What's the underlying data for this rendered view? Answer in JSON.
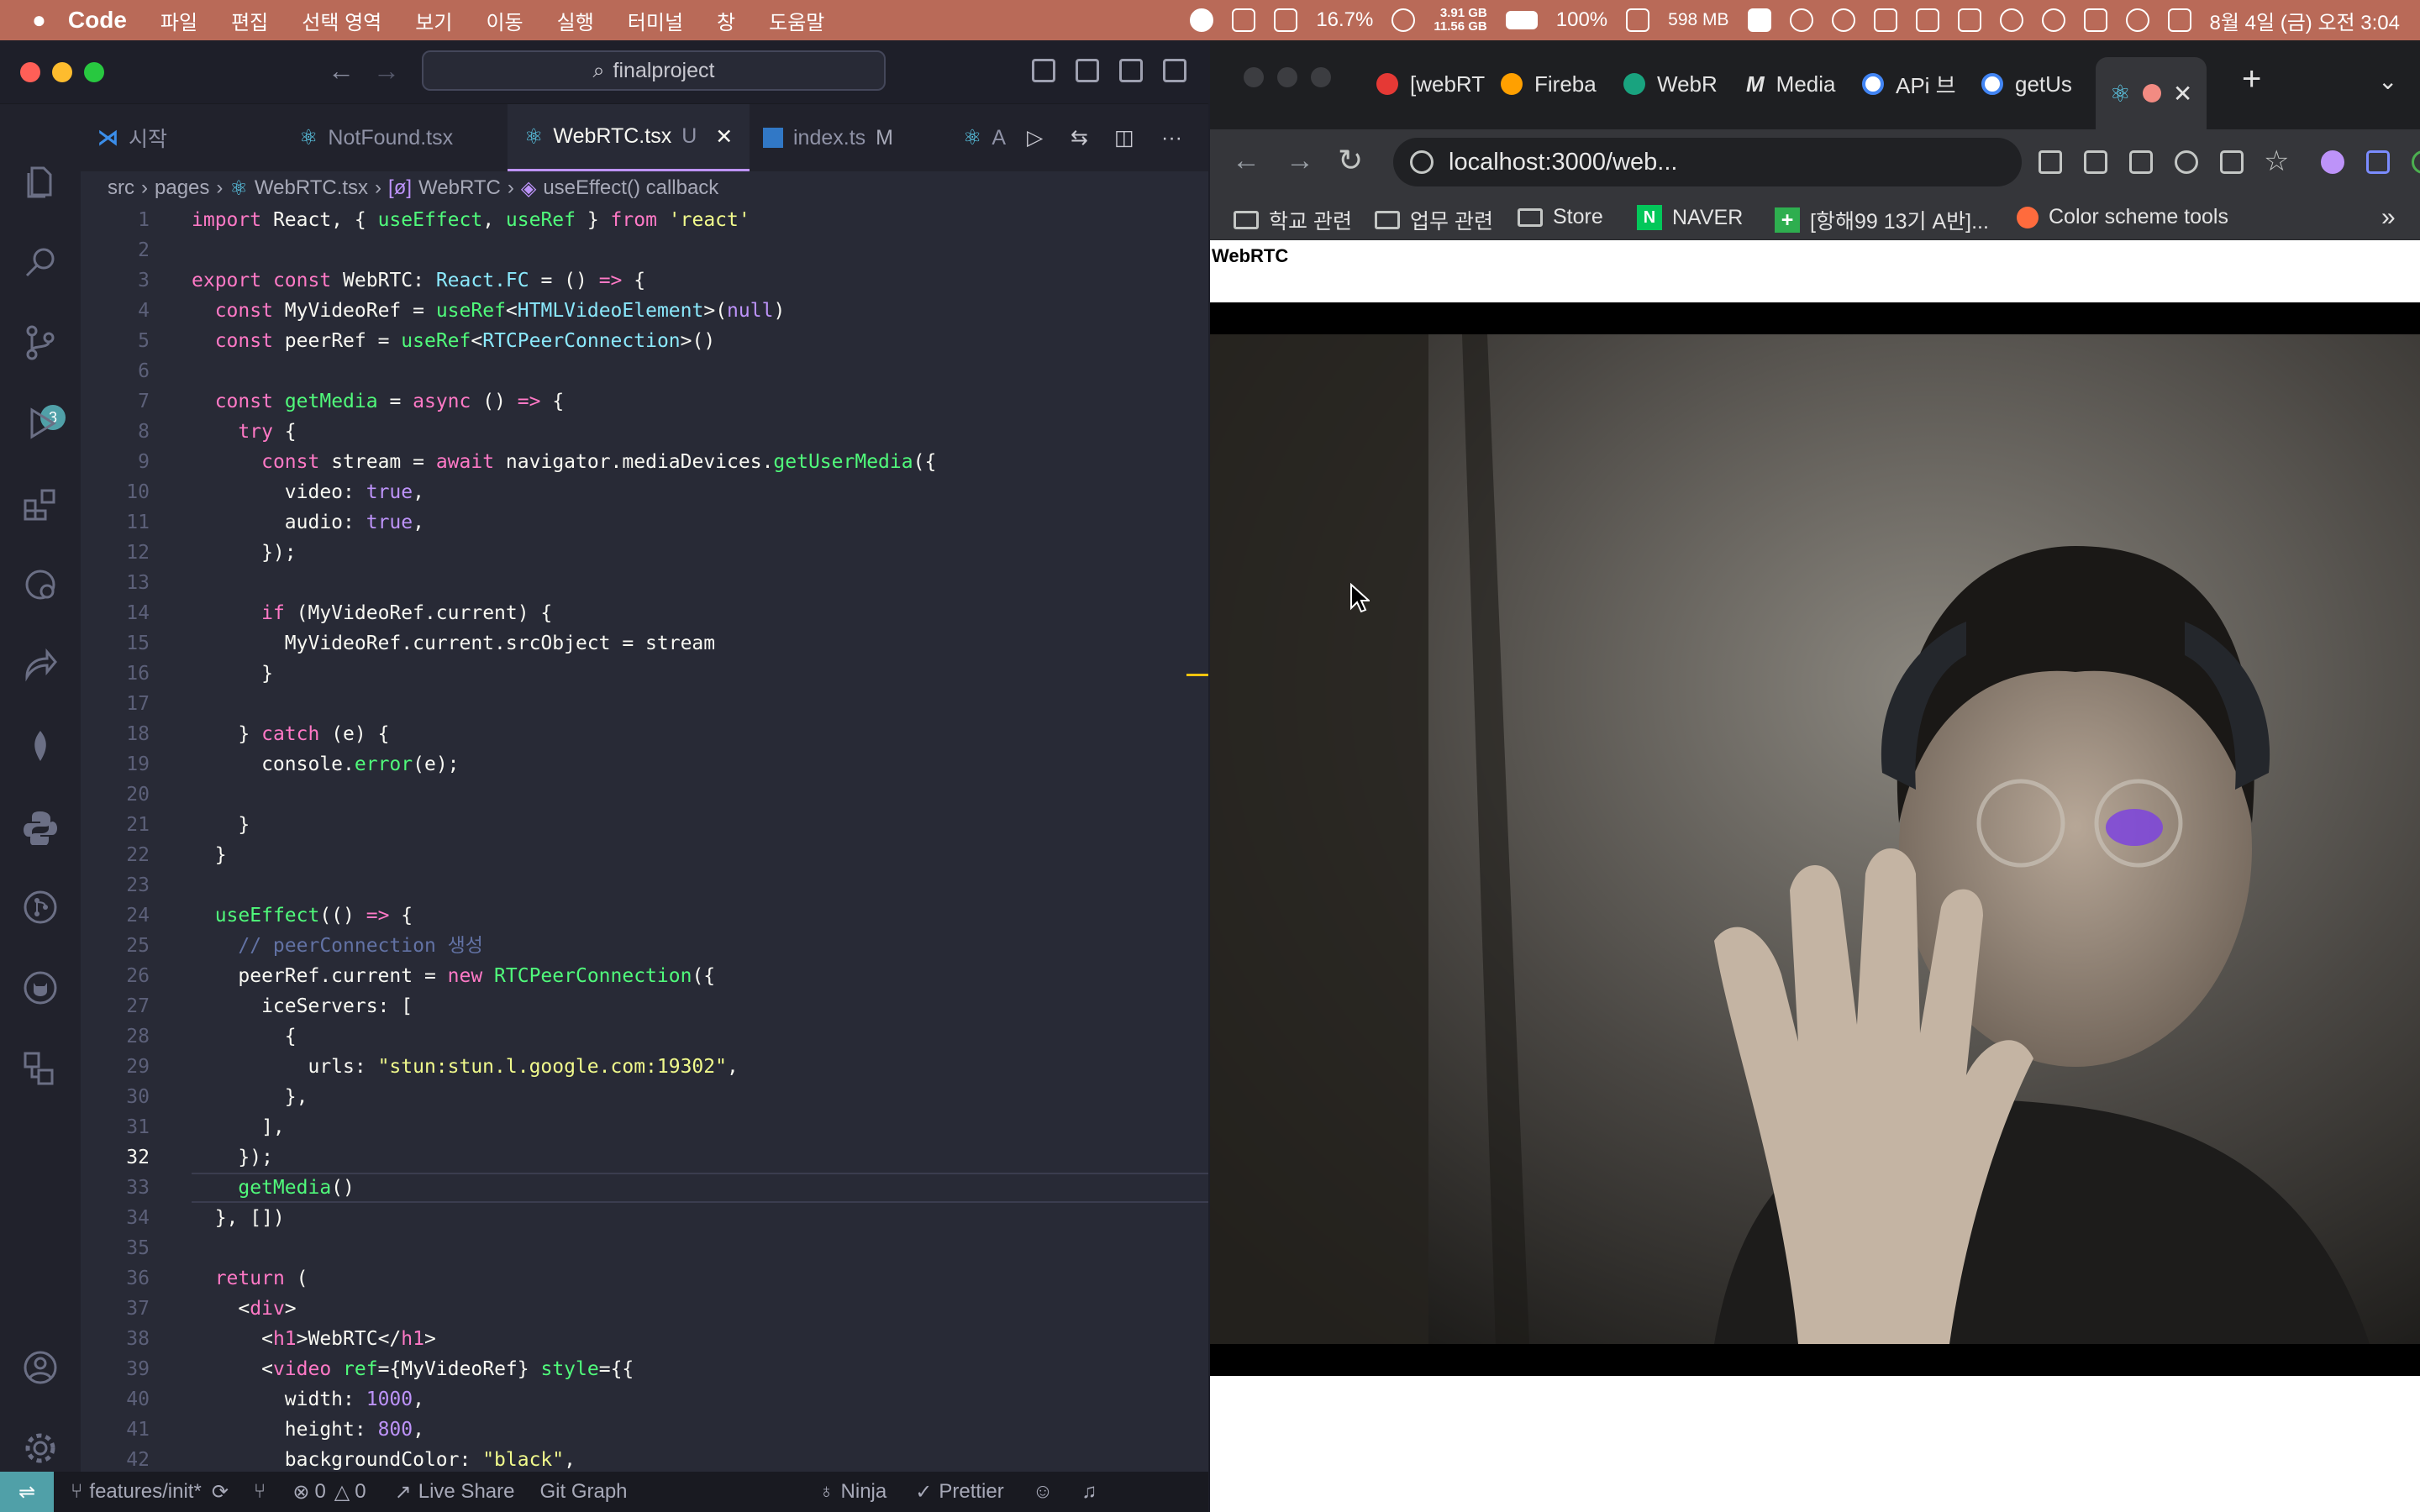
{
  "menubar": {
    "app_name": "Code",
    "items": [
      "파일",
      "편집",
      "선택 영역",
      "보기",
      "이동",
      "실행",
      "터미널",
      "창",
      "도움말"
    ],
    "cpu": "16.7%",
    "mem_top": "3.91 GB",
    "mem_bottom": "11.56 GB",
    "battery": "100%",
    "memory": "598 MB",
    "clock": "8월 4일 (금) 오전 3:04"
  },
  "vscode": {
    "search": "finalproject",
    "badge_count": "3",
    "tabs": [
      {
        "label": "시작",
        "mod": ""
      },
      {
        "label": "NotFound.tsx",
        "mod": ""
      },
      {
        "label": "WebRTC.tsx",
        "mod": "U"
      },
      {
        "label": "index.ts",
        "mod": "M"
      }
    ],
    "tab_extra": "A",
    "breadcrumb": [
      "src",
      "pages",
      "WebRTC.tsx",
      "WebRTC",
      "useEffect() callback"
    ],
    "line_numbers": [
      "1",
      "2",
      "3",
      "4",
      "5",
      "6",
      "7",
      "8",
      "9",
      "10",
      "11",
      "12",
      "13",
      "14",
      "15",
      "16",
      "17",
      "18",
      "19",
      "20",
      "21",
      "22",
      "23",
      "24",
      "25",
      "26",
      "27",
      "28",
      "29",
      "30",
      "31",
      "32",
      "33",
      "34",
      "35",
      "36",
      "37",
      "38",
      "39",
      "40",
      "41",
      "42"
    ],
    "status": {
      "branch": "features/init*",
      "errors": "0",
      "warnings": "0",
      "live_share": "Live Share",
      "git_graph": "Git Graph",
      "ninja": "Ninja",
      "prettier": "Prettier"
    }
  },
  "code_lines": [
    [
      {
        "t": "import",
        "c": "k"
      },
      {
        "t": " React, { "
      },
      {
        "t": "useEffect",
        "c": "f"
      },
      {
        "t": ", "
      },
      {
        "t": "useRef",
        "c": "f"
      },
      {
        "t": " } "
      },
      {
        "t": "from",
        "c": "k"
      },
      {
        "t": " "
      },
      {
        "t": "'react'",
        "c": "s"
      }
    ],
    [],
    [
      {
        "t": "export",
        "c": "k"
      },
      {
        "t": " "
      },
      {
        "t": "const",
        "c": "k"
      },
      {
        "t": " WebRTC: "
      },
      {
        "t": "React.FC",
        "c": "t"
      },
      {
        "t": " = () "
      },
      {
        "t": "=>",
        "c": "k"
      },
      {
        "t": " {"
      }
    ],
    [
      {
        "t": "  "
      },
      {
        "t": "const",
        "c": "k"
      },
      {
        "t": " MyVideoRef = "
      },
      {
        "t": "useRef",
        "c": "f"
      },
      {
        "t": "<"
      },
      {
        "t": "HTMLVideoElement",
        "c": "t"
      },
      {
        "t": ">("
      },
      {
        "t": "null",
        "c": "v"
      },
      {
        "t": ")"
      }
    ],
    [
      {
        "t": "  "
      },
      {
        "t": "const",
        "c": "k"
      },
      {
        "t": " peerRef = "
      },
      {
        "t": "useRef",
        "c": "f"
      },
      {
        "t": "<"
      },
      {
        "t": "RTCPeerConnection",
        "c": "t"
      },
      {
        "t": ">()"
      }
    ],
    [],
    [
      {
        "t": "  "
      },
      {
        "t": "const",
        "c": "k"
      },
      {
        "t": " "
      },
      {
        "t": "getMedia",
        "c": "f"
      },
      {
        "t": " = "
      },
      {
        "t": "async",
        "c": "k"
      },
      {
        "t": " () "
      },
      {
        "t": "=>",
        "c": "k"
      },
      {
        "t": " {"
      }
    ],
    [
      {
        "t": "    "
      },
      {
        "t": "try",
        "c": "k"
      },
      {
        "t": " {"
      }
    ],
    [
      {
        "t": "      "
      },
      {
        "t": "const",
        "c": "k"
      },
      {
        "t": " stream = "
      },
      {
        "t": "await",
        "c": "k"
      },
      {
        "t": " navigator.mediaDevices."
      },
      {
        "t": "getUserMedia",
        "c": "f"
      },
      {
        "t": "({"
      }
    ],
    [
      {
        "t": "        video: "
      },
      {
        "t": "true",
        "c": "v"
      },
      {
        "t": ","
      }
    ],
    [
      {
        "t": "        audio: "
      },
      {
        "t": "true",
        "c": "v"
      },
      {
        "t": ","
      }
    ],
    [
      {
        "t": "      });"
      }
    ],
    [],
    [
      {
        "t": "      "
      },
      {
        "t": "if",
        "c": "k"
      },
      {
        "t": " (MyVideoRef.current) {"
      }
    ],
    [
      {
        "t": "        MyVideoRef.current.srcObject = stream"
      }
    ],
    [
      {
        "t": "      }"
      }
    ],
    [],
    [
      {
        "t": "    } "
      },
      {
        "t": "catch",
        "c": "k"
      },
      {
        "t": " (e) {"
      }
    ],
    [
      {
        "t": "      console."
      },
      {
        "t": "error",
        "c": "f"
      },
      {
        "t": "(e);"
      }
    ],
    [],
    [
      {
        "t": "    }"
      }
    ],
    [
      {
        "t": "  }"
      }
    ],
    [],
    [
      {
        "t": "  "
      },
      {
        "t": "useEffect",
        "c": "f"
      },
      {
        "t": "(() "
      },
      {
        "t": "=>",
        "c": "k"
      },
      {
        "t": " {"
      }
    ],
    [
      {
        "t": "    "
      },
      {
        "t": "// peerConnection 생성",
        "c": "c"
      }
    ],
    [
      {
        "t": "    peerRef.current = "
      },
      {
        "t": "new",
        "c": "k"
      },
      {
        "t": " "
      },
      {
        "t": "RTCPeerConnection",
        "c": "f"
      },
      {
        "t": "({"
      }
    ],
    [
      {
        "t": "      iceServers: ["
      }
    ],
    [
      {
        "t": "        {"
      }
    ],
    [
      {
        "t": "          urls: "
      },
      {
        "t": "\"stun:stun.l.google.com:19302\"",
        "c": "s"
      },
      {
        "t": ","
      }
    ],
    [
      {
        "t": "        },"
      }
    ],
    [
      {
        "t": "      ],"
      }
    ],
    [
      {
        "t": "    });"
      }
    ],
    [
      {
        "t": "    "
      },
      {
        "t": "getMedia",
        "c": "f"
      },
      {
        "t": "()"
      }
    ],
    [
      {
        "t": "  }, [])"
      }
    ],
    [],
    [
      {
        "t": "  "
      },
      {
        "t": "return",
        "c": "k"
      },
      {
        "t": " ("
      }
    ],
    [
      {
        "t": "    <"
      },
      {
        "t": "div",
        "c": "k"
      },
      {
        "t": ">"
      }
    ],
    [
      {
        "t": "      <"
      },
      {
        "t": "h1",
        "c": "k"
      },
      {
        "t": ">WebRTC</"
      },
      {
        "t": "h1",
        "c": "k"
      },
      {
        "t": ">"
      }
    ],
    [
      {
        "t": "      <"
      },
      {
        "t": "video",
        "c": "k"
      },
      {
        "t": " "
      },
      {
        "t": "ref",
        "c": "f"
      },
      {
        "t": "={MyVideoRef} "
      },
      {
        "t": "style",
        "c": "f"
      },
      {
        "t": "={{"
      }
    ],
    [
      {
        "t": "        width: "
      },
      {
        "t": "1000",
        "c": "v"
      },
      {
        "t": ","
      }
    ],
    [
      {
        "t": "        height: "
      },
      {
        "t": "800",
        "c": "v"
      },
      {
        "t": ","
      }
    ],
    [
      {
        "t": "        backgroundColor: "
      },
      {
        "t": "\"black\"",
        "c": "s"
      },
      {
        "t": ","
      }
    ]
  ],
  "browser": {
    "tabs": [
      "[webRT",
      "Fireba",
      "WebR",
      "Media",
      "APi 브",
      "getUs"
    ],
    "url": "localhost:3000/web...",
    "bookmarks": [
      "학교 관련",
      "업무 관련",
      "Store",
      "NAVER",
      "[항해99 13기 A반]...",
      "Color scheme tools"
    ],
    "page_title": "WebRTC"
  },
  "colors": {
    "menubar": "#b96a58",
    "editor_bg": "#282a36",
    "accent": "#bd93f9",
    "remote": "#50a0a8"
  }
}
